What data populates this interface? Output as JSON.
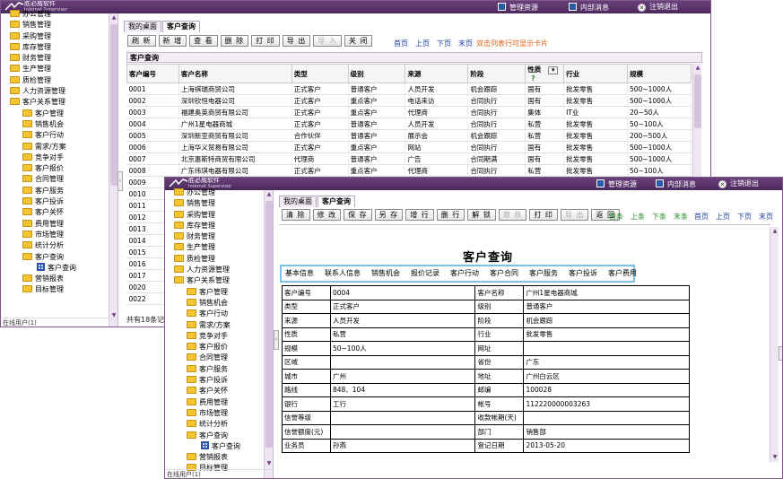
{
  "app": {
    "logo_title": "胜必威软件",
    "logo_sub": "Internet Supervisor",
    "top_buttons": [
      "管理资源",
      "内部消息",
      "注销退出"
    ]
  },
  "tree_items": [
    {
      "label": "办公管理",
      "level": 1,
      "kind": "folder"
    },
    {
      "label": "销售管理",
      "level": 1,
      "kind": "folder"
    },
    {
      "label": "采购管理",
      "level": 1,
      "kind": "folder"
    },
    {
      "label": "库存管理",
      "level": 1,
      "kind": "folder"
    },
    {
      "label": "财务管理",
      "level": 1,
      "kind": "folder"
    },
    {
      "label": "生产管理",
      "level": 1,
      "kind": "folder"
    },
    {
      "label": "质检管理",
      "level": 1,
      "kind": "folder"
    },
    {
      "label": "人力资源管理",
      "level": 1,
      "kind": "folder"
    },
    {
      "label": "客户关系管理",
      "level": 1,
      "kind": "folder"
    },
    {
      "label": "客户管理",
      "level": 2,
      "kind": "folder"
    },
    {
      "label": "销售机会",
      "level": 2,
      "kind": "folder"
    },
    {
      "label": "客户行动",
      "level": 2,
      "kind": "folder"
    },
    {
      "label": "需求/方案",
      "level": 2,
      "kind": "folder"
    },
    {
      "label": "竞争对手",
      "level": 2,
      "kind": "folder"
    },
    {
      "label": "客户报价",
      "level": 2,
      "kind": "folder"
    },
    {
      "label": "合同管理",
      "level": 2,
      "kind": "folder"
    },
    {
      "label": "客户服务",
      "level": 2,
      "kind": "folder"
    },
    {
      "label": "客户投诉",
      "level": 2,
      "kind": "folder"
    },
    {
      "label": "客户关怀",
      "level": 2,
      "kind": "folder"
    },
    {
      "label": "费用管理",
      "level": 2,
      "kind": "folder"
    },
    {
      "label": "市场管理",
      "level": 2,
      "kind": "folder"
    },
    {
      "label": "统计分析",
      "level": 2,
      "kind": "folder"
    },
    {
      "label": "客户查询",
      "level": 2,
      "kind": "folder"
    },
    {
      "label": "客户查询",
      "level": 3,
      "kind": "grid"
    },
    {
      "label": "营销报表",
      "level": 2,
      "kind": "folder"
    },
    {
      "label": "目标管理",
      "level": 2,
      "kind": "folder"
    }
  ],
  "side_footer": "在线用户(1)",
  "w1": {
    "tabs": [
      "我的桌面",
      "客户查询"
    ],
    "buttons": [
      {
        "label": "刷 新",
        "disabled": false
      },
      {
        "label": "新 增",
        "disabled": false
      },
      {
        "label": "查 看",
        "disabled": false
      },
      {
        "label": "删 除",
        "disabled": false
      },
      {
        "label": "打 印",
        "disabled": false
      },
      {
        "label": "导 出",
        "disabled": false
      },
      {
        "label": "导 入",
        "disabled": true
      },
      {
        "label": "关 闭",
        "disabled": false
      }
    ],
    "nav_links": [
      "首页",
      "上页",
      "下页",
      "末页"
    ],
    "card_hint": "双击列表行可显示卡片",
    "panel_title": "客户查询",
    "columns": [
      "客户编号",
      "客户名称",
      "类型",
      "级别",
      "来源",
      "阶段",
      "性质",
      "行业",
      "规模"
    ],
    "rows": [
      [
        "0001",
        "上海祺瑞商贸公司",
        "正式客户",
        "普通客户",
        "人员开发",
        "机会跟踪",
        "国有",
        "批发零售",
        "500~1000人"
      ],
      [
        "0002",
        "深圳钦恒电器公司",
        "正式客户",
        "重点客户",
        "电话来访",
        "合同执行",
        "国有",
        "批发零售",
        "500~1000人"
      ],
      [
        "0003",
        "福建奥英商贸有限公司",
        "正式客户",
        "重点客户",
        "代理商",
        "合同执行",
        "集体",
        "IT业",
        "20~50人"
      ],
      [
        "0004",
        "广州1星电器商城",
        "正式客户",
        "普通客户",
        "人员开发",
        "合同执行",
        "私营",
        "批发零售",
        "50~100人"
      ],
      [
        "0005",
        "深圳新亚商贸有限公司",
        "合作伙伴",
        "普通客户",
        "展示会",
        "机会跟踪",
        "私营",
        "批发零售",
        "200~500人"
      ],
      [
        "0006",
        "上海华义贸易有限公司",
        "正式客户",
        "重点客户",
        "网站",
        "合同执行",
        "国有",
        "批发零售",
        "500~1000人"
      ],
      [
        "0007",
        "北京惠斯特商贸有限公司",
        "代理商",
        "普通客户",
        "广告",
        "合同期满",
        "国有",
        "批发零售",
        "500~1000人"
      ],
      [
        "0008",
        "广东纬琪电器有限公司",
        "正式客户",
        "重点客户",
        "代理商",
        "合同执行",
        "私营",
        "批发零售",
        "50~100人"
      ],
      [
        "0009",
        "",
        "",
        "",
        "",
        "",
        "",
        "",
        ""
      ],
      [
        "0010",
        "",
        "",
        "",
        "",
        "",
        "",
        "",
        ""
      ],
      [
        "0011",
        "",
        "",
        "",
        "",
        "",
        "",
        "",
        ""
      ],
      [
        "0012",
        "",
        "",
        "",
        "",
        "",
        "",
        "",
        ""
      ],
      [
        "0013",
        "",
        "",
        "",
        "",
        "",
        "",
        "",
        ""
      ],
      [
        "0014",
        "",
        "",
        "",
        "",
        "",
        "",
        "",
        ""
      ],
      [
        "0015",
        "",
        "",
        "",
        "",
        "",
        "",
        "",
        ""
      ],
      [
        "0016",
        "",
        "",
        "",
        "",
        "",
        "",
        "",
        ""
      ],
      [
        "0017",
        "",
        "",
        "",
        "",
        "",
        "",
        "",
        ""
      ],
      [
        "0020",
        "",
        "",
        "",
        "",
        "",
        "",
        "",
        ""
      ],
      [
        "0022",
        "",
        "",
        "",
        "",
        "",
        "",
        "",
        ""
      ]
    ],
    "footer": "共有18条记录"
  },
  "w2": {
    "tabs": [
      "我的桌面",
      "客户查询"
    ],
    "buttons": [
      {
        "label": "清 除",
        "disabled": false
      },
      {
        "label": "修 改",
        "disabled": false
      },
      {
        "label": "保 存",
        "disabled": false
      },
      {
        "label": "另 存",
        "disabled": false
      },
      {
        "label": "增 行",
        "disabled": false
      },
      {
        "label": "删 行",
        "disabled": false
      },
      {
        "label": "解 锁",
        "disabled": false
      },
      {
        "label": "审 核",
        "disabled": true
      },
      {
        "label": "打 印",
        "disabled": false
      },
      {
        "label": "导 出",
        "disabled": true
      },
      {
        "label": "返 回",
        "disabled": false
      }
    ],
    "record_links": [
      "首条",
      "上条",
      "下条",
      "末条"
    ],
    "nav_links": [
      "首页",
      "上页",
      "下页",
      "末页"
    ],
    "title": "客户查询",
    "subtabs": [
      "基本信息",
      "联系人信息",
      "销售机会",
      "报价记录",
      "客户行动",
      "客户合同",
      "客户服务",
      "客户投诉",
      "客户费用"
    ],
    "detail": [
      [
        "客户编号",
        "0004",
        "客户名称",
        "广州1星电器商城"
      ],
      [
        "类型",
        "正式客户",
        "级别",
        "普通客户"
      ],
      [
        "来源",
        "人员开发",
        "阶段",
        "机会跟踪"
      ],
      [
        "性质",
        "私营",
        "行业",
        "批发零售"
      ],
      [
        "规模",
        "50~100人",
        "网址",
        ""
      ],
      [
        "区域",
        "",
        "省份",
        "广东"
      ],
      [
        "城市",
        "广州",
        "地址",
        "广州白云区"
      ],
      [
        "路线",
        "848、104",
        "邮编",
        "100028"
      ],
      [
        "银行",
        "工行",
        "帐号",
        "112220000003263"
      ],
      [
        "信誉等级",
        "",
        "收款帐期(天)",
        ""
      ],
      [
        "信誉额度(元)",
        "",
        "部门",
        "销售部"
      ],
      [
        "业务员",
        "孙燕",
        "登记日期",
        "2013-05-20"
      ]
    ]
  }
}
